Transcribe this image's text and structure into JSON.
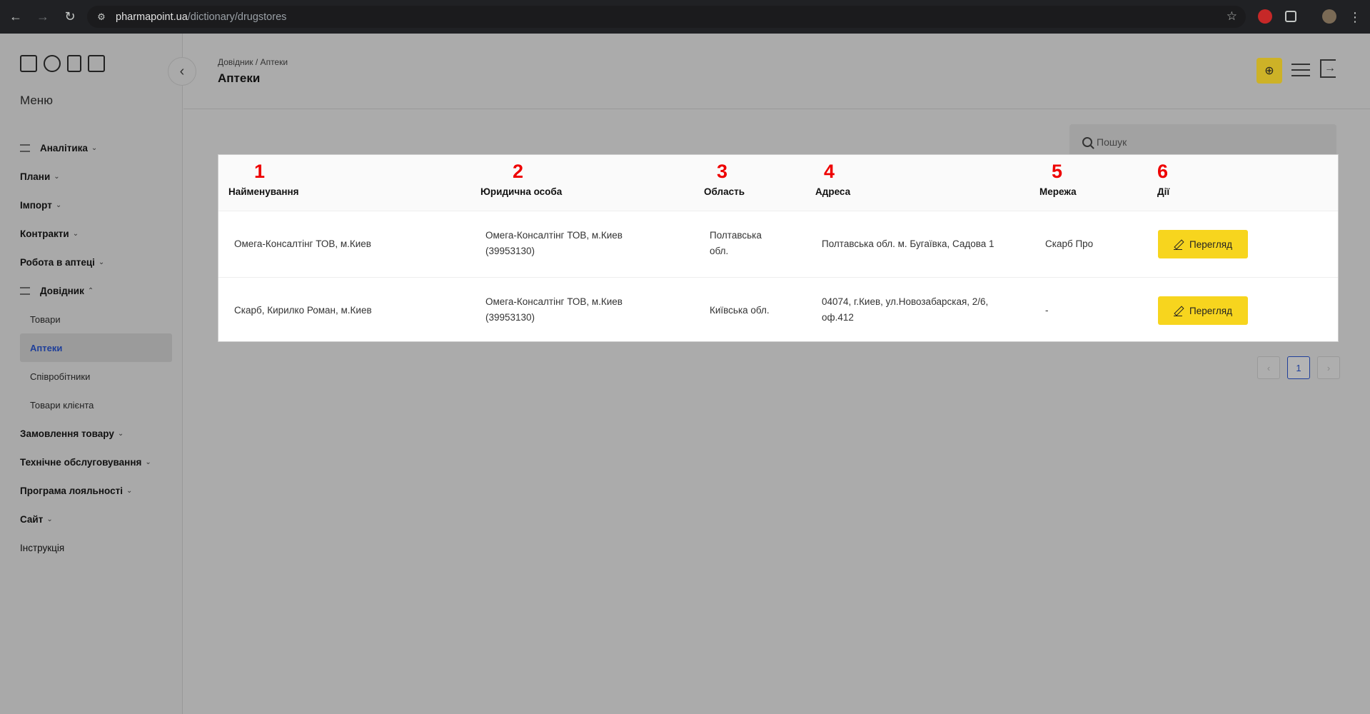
{
  "browser": {
    "url_host": "pharmapoint.ua",
    "url_path": "/dictionary/drugstores"
  },
  "sidebar": {
    "title": "Меню",
    "items": [
      {
        "label": "Аналітика",
        "chevron": "⌄",
        "icon": "grid-icon"
      },
      {
        "label": "Плани",
        "chevron": "⌄"
      },
      {
        "label": "Імпорт",
        "chevron": "⌄"
      },
      {
        "label": "Контракти",
        "chevron": "⌄"
      },
      {
        "label": "Робота в аптеці",
        "chevron": "⌄"
      },
      {
        "label": "Довідник",
        "chevron": "⌃",
        "icon": "list-icon"
      }
    ],
    "subitems": [
      {
        "label": "Товари"
      },
      {
        "label": "Аптеки"
      },
      {
        "label": "Співробітники"
      },
      {
        "label": "Товари клієнта"
      }
    ],
    "items_after": [
      {
        "label": "Замовлення товару",
        "chevron": "⌄"
      },
      {
        "label": "Технічне обслуговування",
        "chevron": "⌄"
      },
      {
        "label": "Програма лояльності",
        "chevron": "⌄"
      },
      {
        "label": "Сайт",
        "chevron": "⌄"
      },
      {
        "label": "Інструкція"
      }
    ]
  },
  "header": {
    "breadcrumb": "Довідник / Аптеки",
    "title": "Аптеки"
  },
  "search": {
    "placeholder": "Пошук"
  },
  "table": {
    "column_numbers": [
      "1",
      "2",
      "3",
      "4",
      "5",
      "6"
    ],
    "columns": [
      "Найменування",
      "Юридична особа",
      "Область",
      "Адреса",
      "Мережа",
      "Дії"
    ],
    "rows": [
      {
        "name": "Омега-Консалтінг ТОВ, м.Киев",
        "legal_1": "Омега-Консалтінг ТОВ, м.Киев",
        "legal_2": "(39953130)",
        "region_1": "Полтавська",
        "region_2": "обл.",
        "address_1": "Полтавська обл. м. Бугаївка, Садова 1",
        "address_2": "",
        "network": "Скарб Про",
        "action": "Перегляд"
      },
      {
        "name": "Скарб, Кирилко Роман, м.Киев",
        "legal_1": "Омега-Консалтінг ТОВ, м.Киев",
        "legal_2": "(39953130)",
        "region_1": "Київська обл.",
        "region_2": "",
        "address_1": "04074, г.Киев, ул.Новозабарская, 2/6,",
        "address_2": "оф.412",
        "network": "-",
        "action": "Перегляд"
      }
    ]
  },
  "pagination": {
    "prev": "‹",
    "current": "1",
    "next": "›"
  }
}
